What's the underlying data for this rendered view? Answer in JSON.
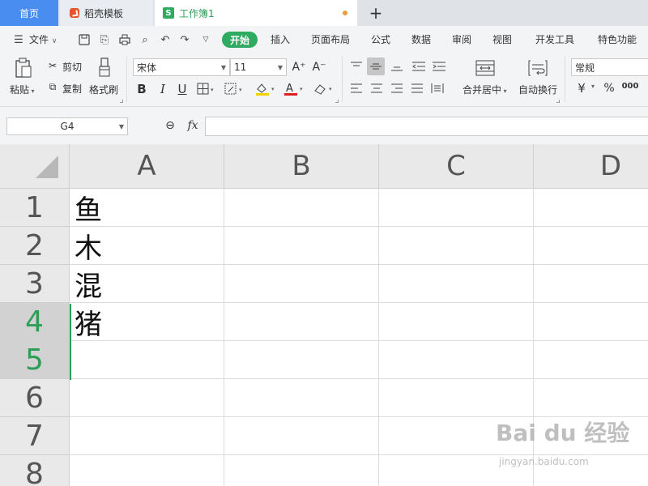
{
  "tabs": {
    "home": "首页",
    "docer": "稻壳模板",
    "workbook": "工作簿1",
    "add": "+"
  },
  "menu": {
    "file": "文件",
    "items": [
      "开始",
      "插入",
      "页面布局",
      "公式",
      "数据",
      "审阅",
      "视图",
      "开发工具",
      "特色功能"
    ]
  },
  "ribbon": {
    "paste": "粘贴",
    "cut": "剪切",
    "copy": "复制",
    "format_painter": "格式刷",
    "font_name": "宋体",
    "font_size": "11",
    "merge_center": "合并居中",
    "wrap_text": "自动换行",
    "number_format": "常规",
    "bold": "B",
    "italic": "I",
    "underline": "U",
    "currency": "¥",
    "percent": "%",
    "thousands": "000"
  },
  "formula_bar": {
    "name_box": "G4",
    "fx": "fx",
    "formula": ""
  },
  "grid": {
    "columns": [
      "A",
      "B",
      "C",
      "D"
    ],
    "rows": [
      "1",
      "2",
      "3",
      "4",
      "5",
      "6",
      "7",
      "8"
    ],
    "active_row": "5",
    "cells_A": [
      "鱼",
      "木",
      "混",
      "猪",
      "",
      "",
      "",
      ""
    ]
  },
  "watermark": {
    "brand": "Bai du 经验",
    "url": "jingyan.baidu.com"
  },
  "colors": {
    "accent_green": "#2eab60",
    "home_tab_blue": "#4a8df0",
    "modified_dot": "#f19a3a"
  }
}
